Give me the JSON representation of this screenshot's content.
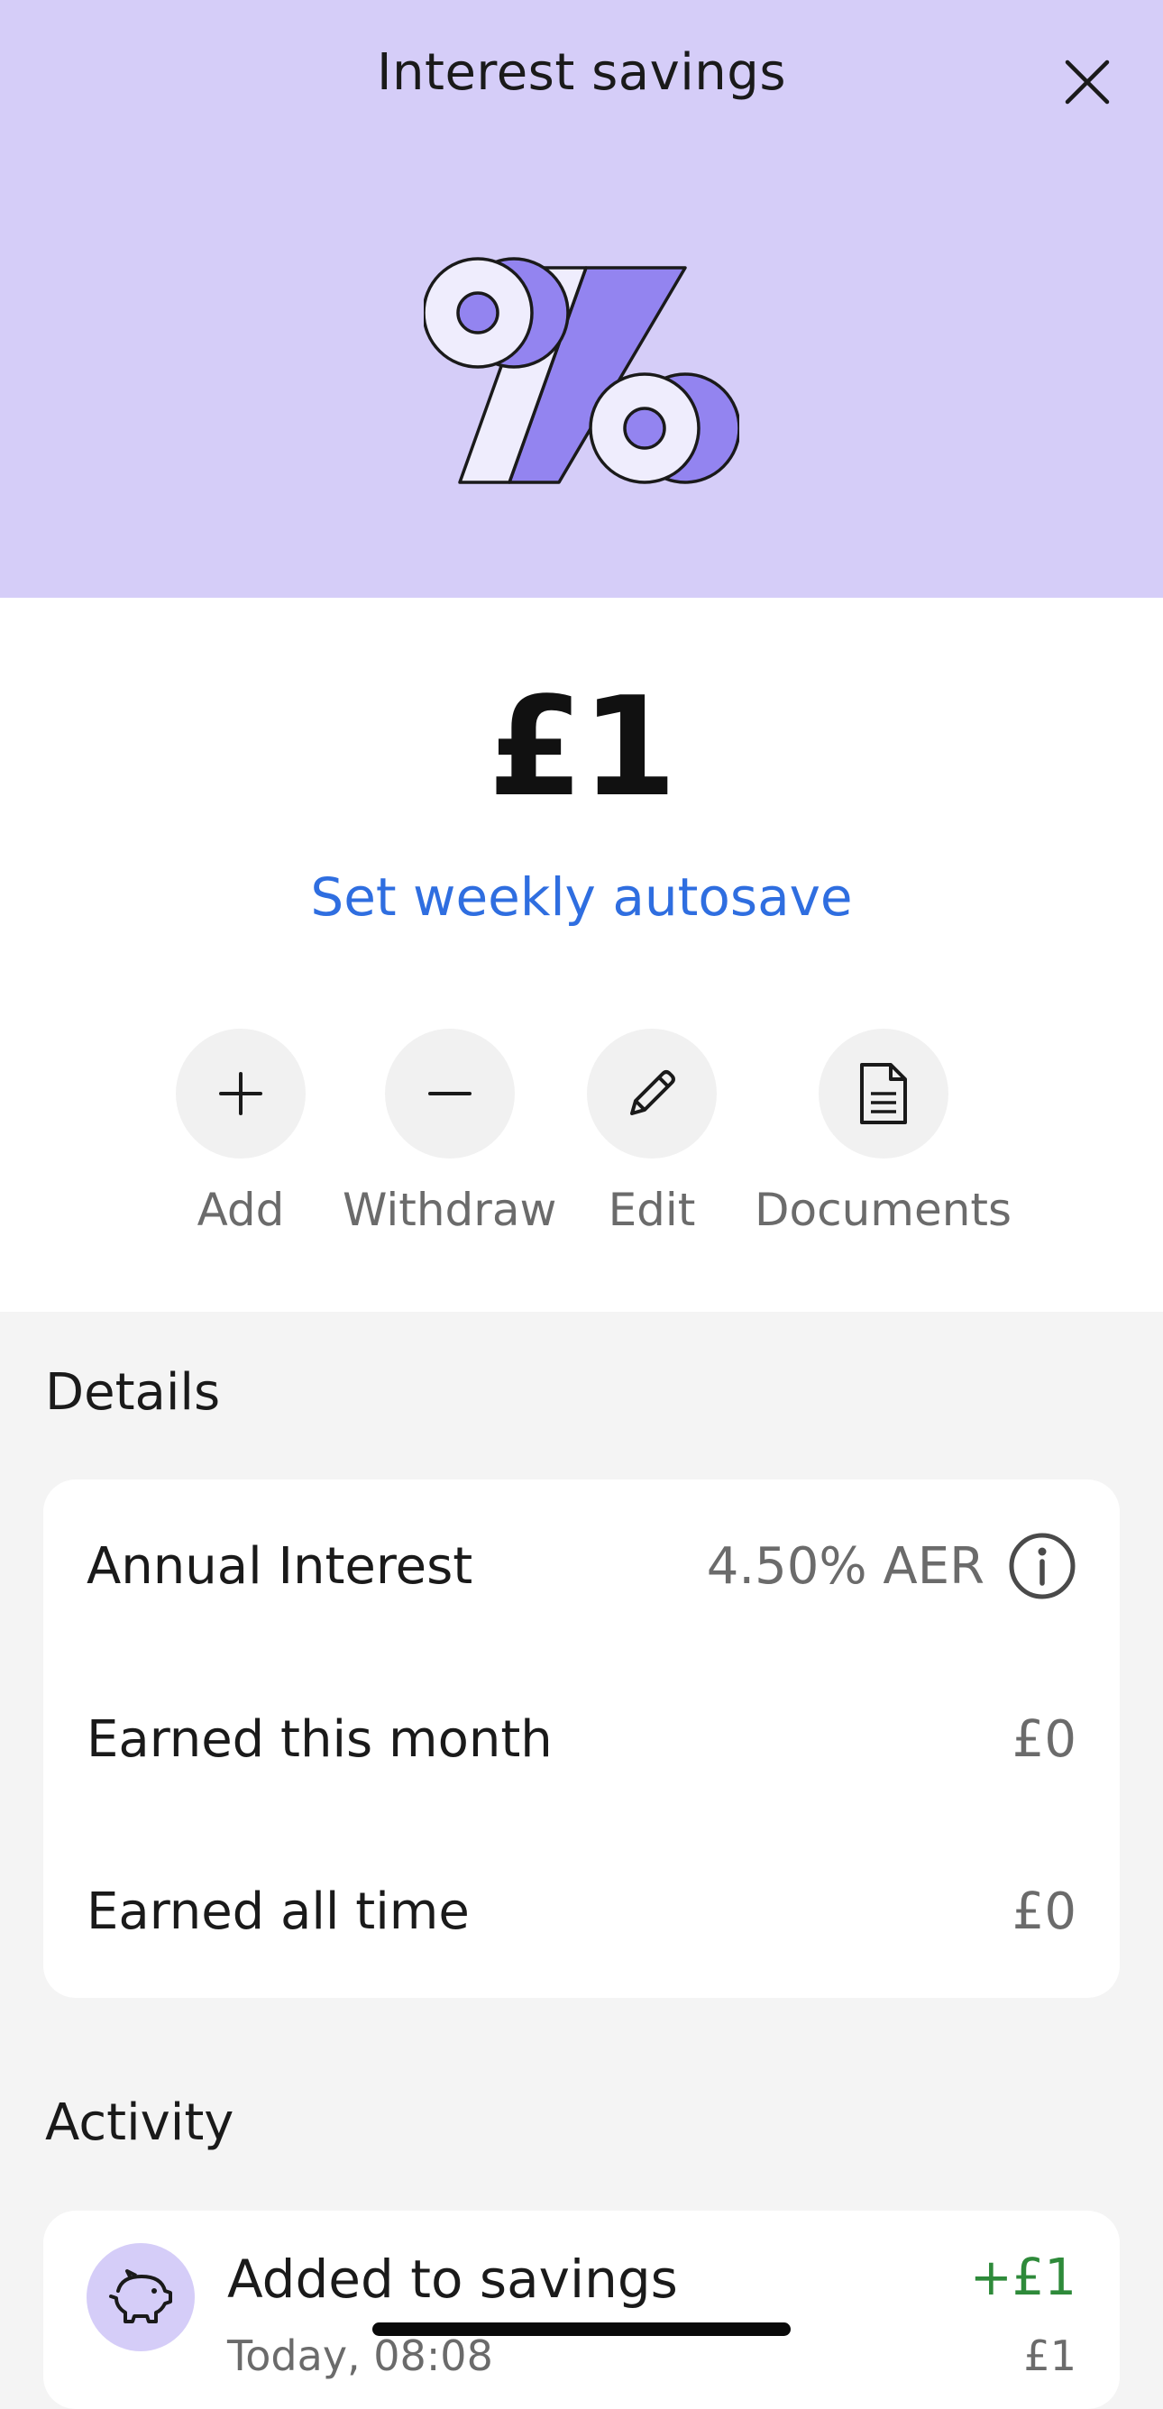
{
  "header": {
    "title": "Interest savings",
    "close_icon": "close-icon",
    "illustration": "percent-icon"
  },
  "balance": {
    "amount": "£1",
    "autosave_link": "Set weekly autosave"
  },
  "actions": [
    {
      "label": "Add",
      "icon": "plus-icon"
    },
    {
      "label": "Withdraw",
      "icon": "minus-icon"
    },
    {
      "label": "Edit",
      "icon": "pencil-icon"
    },
    {
      "label": "Documents",
      "icon": "document-icon"
    }
  ],
  "details": {
    "title": "Details",
    "rows": [
      {
        "label": "Annual Interest",
        "value": "4.50% AER",
        "icon": "info-icon"
      },
      {
        "label": "Earned this month",
        "value": "£0"
      },
      {
        "label": "Earned all time",
        "value": "£0"
      }
    ]
  },
  "activity": {
    "title": "Activity",
    "items": [
      {
        "title": "Added to savings",
        "amount": "+£1",
        "subtitle": "Today, 08:08",
        "balance": "£1",
        "icon": "piggy-bank-icon"
      }
    ]
  },
  "colors": {
    "hero_background": "#d5cdf8",
    "accent_purple": "#9384f0",
    "link_blue": "#2f6ee0",
    "positive_green": "#2e8a3a",
    "page_background": "#f4f4f4"
  }
}
